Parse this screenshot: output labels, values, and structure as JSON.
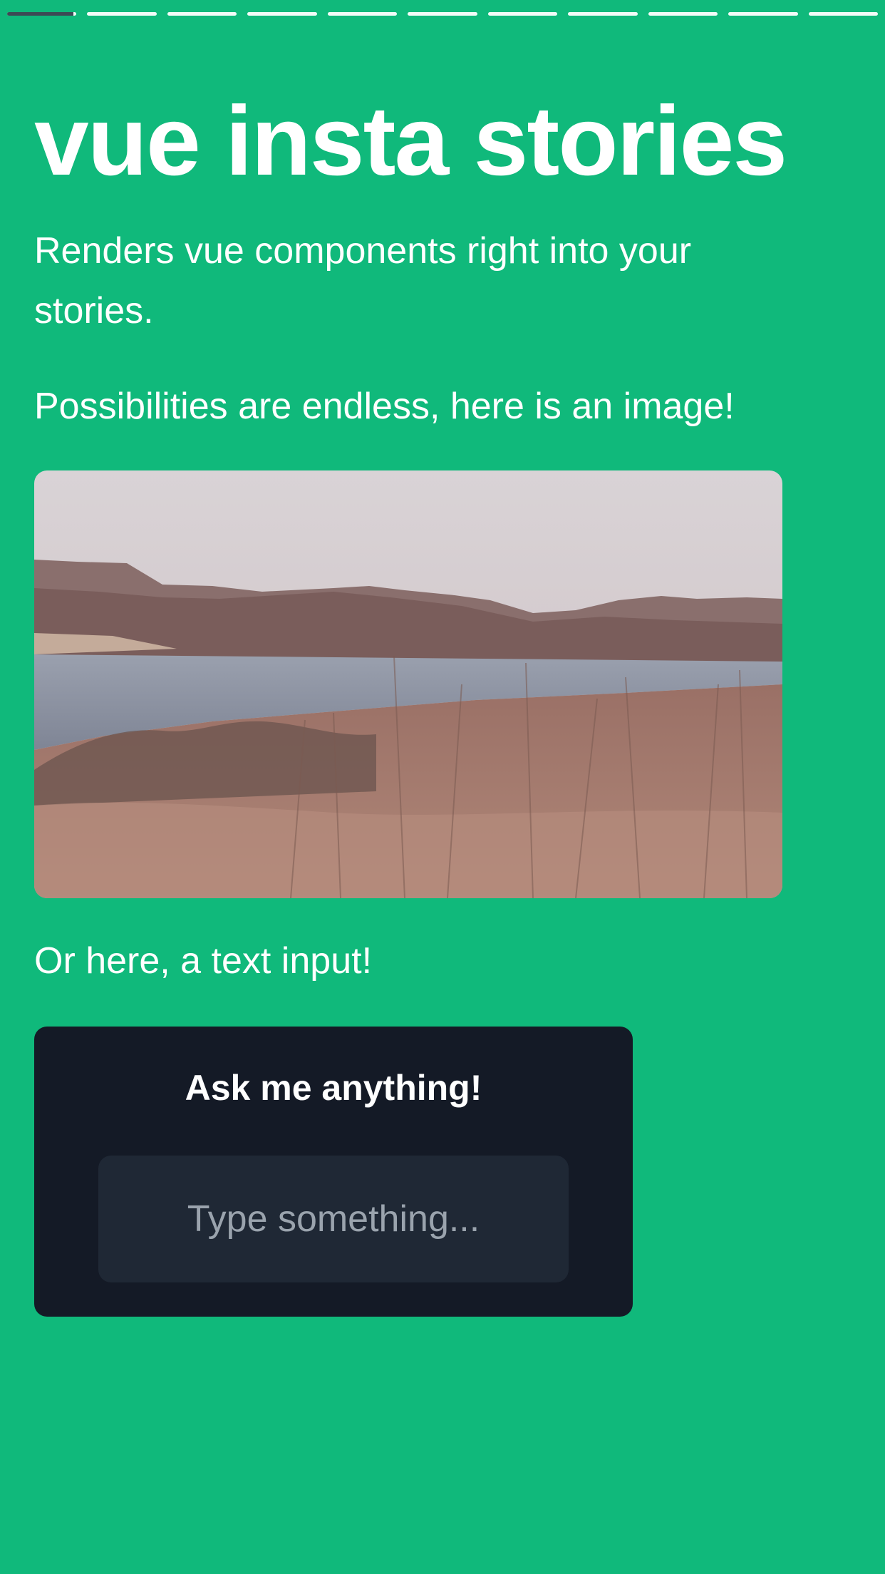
{
  "progress": {
    "segments": 11,
    "active_index": 0,
    "active_fill": 0.95
  },
  "story": {
    "title": "vue insta stories",
    "description": "Renders vue components right into your stories.",
    "image_caption": "Possibilities are endless, here is an image!",
    "input_caption": "Or here, a text input!"
  },
  "ask_card": {
    "heading": "Ask me anything!",
    "placeholder": "Type something..."
  },
  "colors": {
    "background": "#10b97b",
    "card": "#141a26",
    "input": "#1f2835",
    "progress_fill": "#3d4a55"
  }
}
